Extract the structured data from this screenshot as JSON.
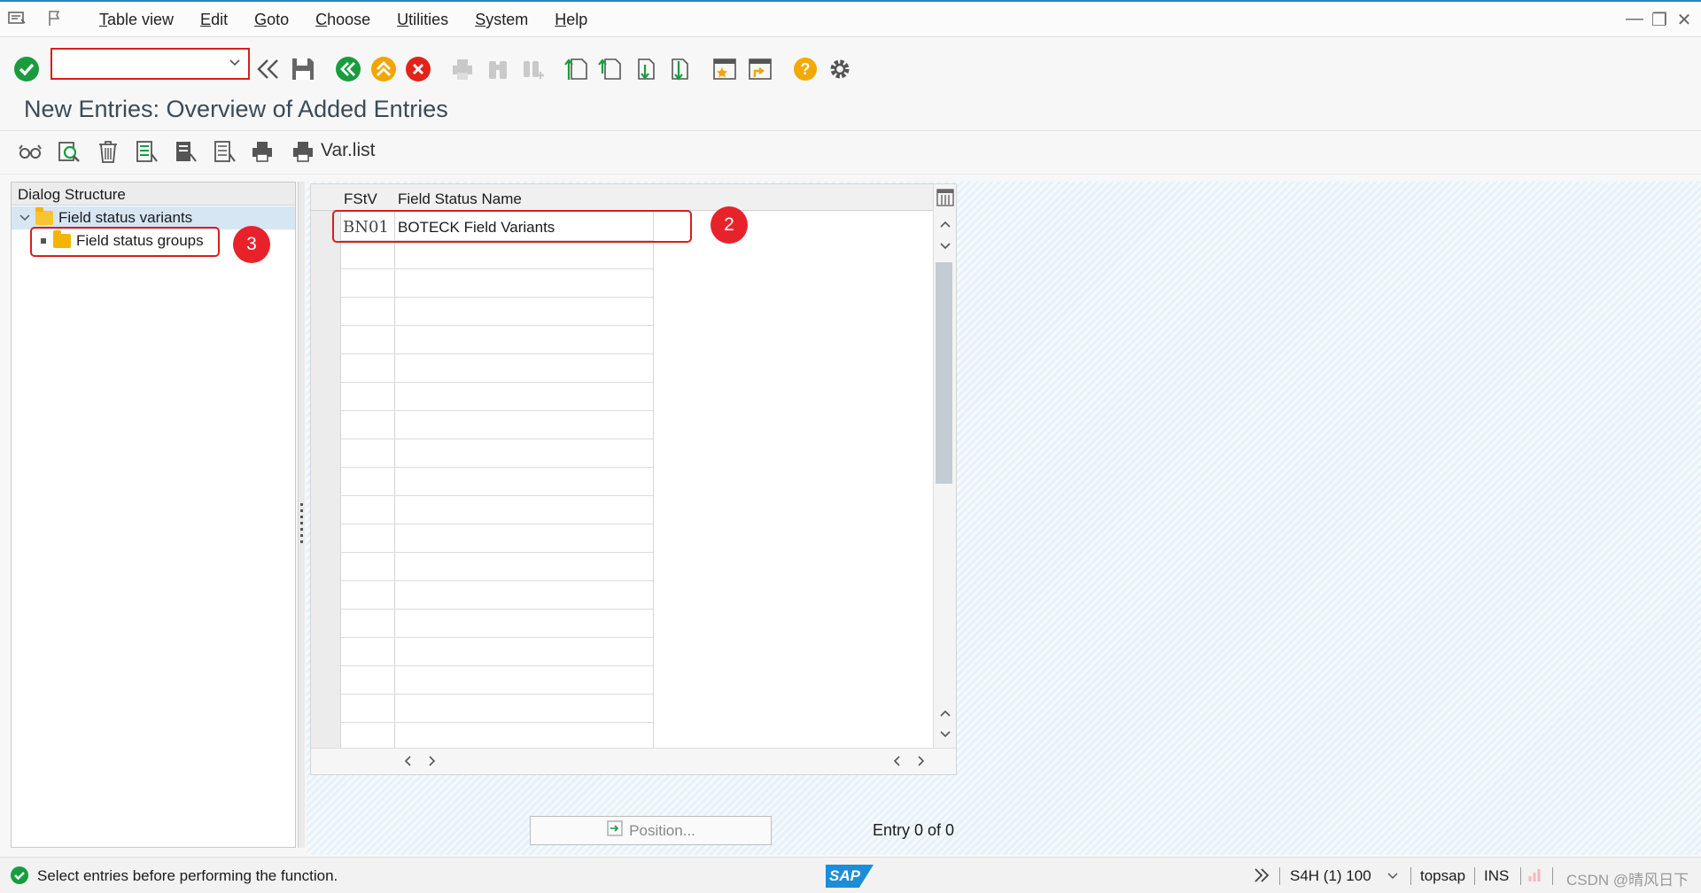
{
  "menu": {
    "items": [
      {
        "underline": "T",
        "rest": "able view"
      },
      {
        "underline": "E",
        "rest": "dit"
      },
      {
        "underline": "G",
        "rest": "oto"
      },
      {
        "underline": "C",
        "rest": "hoose"
      },
      {
        "underline": "U",
        "rest": "tilities"
      },
      {
        "underline": "S",
        "rest": "ystem"
      },
      {
        "underline": "H",
        "rest": "elp"
      }
    ]
  },
  "toolbar": {
    "command_value": "",
    "colors": {
      "green": "#1a9c3e",
      "orange": "#f0a500",
      "red": "#e2231a",
      "grey": "#8a8a8a",
      "help": "#f2a900"
    }
  },
  "screen": {
    "title": "New Entries: Overview of Added Entries"
  },
  "app_toolbar": {
    "var_list_label": "Var.list"
  },
  "dialog_structure": {
    "header": "Dialog Structure",
    "items": [
      {
        "label": "Field status variants",
        "selected": true
      },
      {
        "label": "Field status groups",
        "selected": false
      }
    ]
  },
  "table": {
    "columns": [
      "FStV",
      "Field Status Name"
    ],
    "rows": [
      {
        "fstv": "BN01",
        "name": "BOTECK Field Variants"
      }
    ]
  },
  "annotations": {
    "badge_table": "2",
    "badge_tree": "3"
  },
  "footer": {
    "position_button": "Position...",
    "entry_count": "Entry 0 of 0"
  },
  "statusbar": {
    "message": "Select entries before performing the function.",
    "system": "S4H (1) 100",
    "user": "topsap",
    "mode": "INS",
    "watermark": "CSDN @晴风日下",
    "logo": "SAP"
  }
}
